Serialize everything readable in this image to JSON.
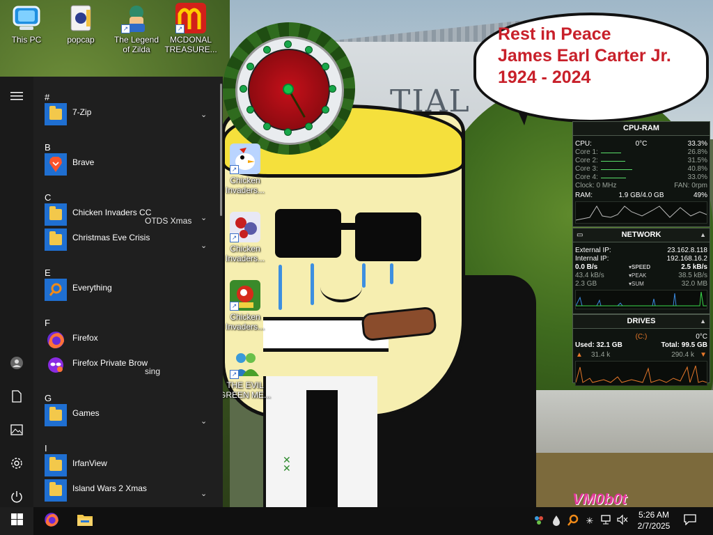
{
  "wallpaper": {
    "bubble_lines": [
      "Rest in Peace",
      "James Earl Carter Jr.",
      "1924 - 2024"
    ],
    "building_text": "TIAL",
    "watermark": "VM0b0t"
  },
  "desktop_icons": [
    {
      "label": "This PC",
      "icon": "computer-icon"
    },
    {
      "label": "popcap",
      "icon": "folder-icon"
    },
    {
      "label": "The Legend of Zilda",
      "icon": "game-icon"
    },
    {
      "label": "MCDONAL TREASURE...",
      "icon": "game-icon"
    },
    {
      "label": "Chicken Invaders...",
      "icon": "chicken-icon"
    },
    {
      "label": "Chicken Invaders...",
      "icon": "chicken-icon"
    },
    {
      "label": "Chicken Invaders...",
      "icon": "chicken-icon"
    },
    {
      "label": "THE EVIL GREEN ME...",
      "icon": "people-icon"
    }
  ],
  "start_menu": {
    "rail": [
      "hamburger-icon",
      "user-icon",
      "documents-icon",
      "pictures-icon",
      "settings-icon",
      "power-icon"
    ],
    "groups": [
      {
        "letter": "#",
        "apps": [
          {
            "name": "7-Zip",
            "icon": "folder-icon",
            "expandable": true
          }
        ]
      },
      {
        "letter": "B",
        "apps": [
          {
            "name": "Brave",
            "icon": "brave-icon",
            "expandable": false
          }
        ]
      },
      {
        "letter": "C",
        "apps": [
          {
            "name": "Chicken Invaders CC",
            "icon": "folder-icon",
            "expandable": true
          },
          {
            "name": "Christmas Eve Crisis",
            "icon": "folder-icon",
            "expandable": true
          }
        ]
      },
      {
        "letter": "E",
        "apps": [
          {
            "name": "Everything",
            "icon": "search-icon",
            "expandable": false
          }
        ]
      },
      {
        "letter": "F",
        "apps": [
          {
            "name": "Firefox",
            "icon": "firefox-icon",
            "expandable": false
          },
          {
            "name": "Firefox Private Brow",
            "icon": "private-browsing-icon",
            "expandable": false
          }
        ]
      },
      {
        "letter": "G",
        "apps": [
          {
            "name": "Games",
            "icon": "folder-icon",
            "expandable": true
          }
        ]
      },
      {
        "letter": "I",
        "apps": [
          {
            "name": "IrfanView",
            "icon": "folder-icon",
            "expandable": true
          },
          {
            "name": "Island Wars 2 Xmas",
            "icon": "folder-icon",
            "expandable": true
          }
        ]
      }
    ],
    "ghost_text": [
      "OTDS Xmas",
      "sing"
    ]
  },
  "gadgets": {
    "cpu_ram": {
      "title": "CPU-RAM",
      "cpu_label": "CPU:",
      "cpu_temp": "0°C",
      "cpu_pct": "33.3%",
      "cores": [
        {
          "label": "Core 1:",
          "pct": "26.8%",
          "frac": 0.268
        },
        {
          "label": "Core 2:",
          "pct": "31.5%",
          "frac": 0.315
        },
        {
          "label": "Core 3:",
          "pct": "40.8%",
          "frac": 0.408
        },
        {
          "label": "Core 4:",
          "pct": "33.0%",
          "frac": 0.33
        }
      ],
      "clock": "Clock: 0 MHz",
      "fan": "FAN: 0rpm",
      "ram_label": "RAM:",
      "ram_used": "1.9 GB/4.0 GB",
      "ram_pct": "49%"
    },
    "network": {
      "title": "NETWORK",
      "ext_label": "External IP:",
      "ext_ip": "23.162.8.118",
      "int_label": "Internal IP:",
      "int_ip": "192.168.16.2",
      "rows": [
        {
          "left": "0.0 B/s",
          "tag": "SPEED",
          "right": "2.5 kB/s"
        },
        {
          "left": "43.4 kB/s",
          "tag": "PEAK",
          "right": "38.5 kB/s"
        },
        {
          "left": "2.3 GB",
          "tag": "SUM",
          "right": "32.0 MB"
        }
      ]
    },
    "drives": {
      "title": "DRIVES",
      "drive": "(C:)",
      "temp": "0°C",
      "used": "Used: 32.1 GB",
      "total": "Total: 99.5 GB",
      "read": "31.4 k",
      "write": "290.4 k"
    }
  },
  "taskbar": {
    "pinned": [
      "firefox-icon",
      "file-explorer-icon"
    ],
    "tray": [
      "people-icon",
      "drop-icon",
      "search-icon",
      "spark-icon",
      "network-icon",
      "volume-muted-icon"
    ],
    "time": "5:26 AM",
    "date": "2/7/2025"
  },
  "colors": {
    "accent": "#1f6fd1",
    "bubble_text": "#c8202a",
    "gadget_line": "#5adf6a",
    "drive_graph": "#e8792a"
  }
}
